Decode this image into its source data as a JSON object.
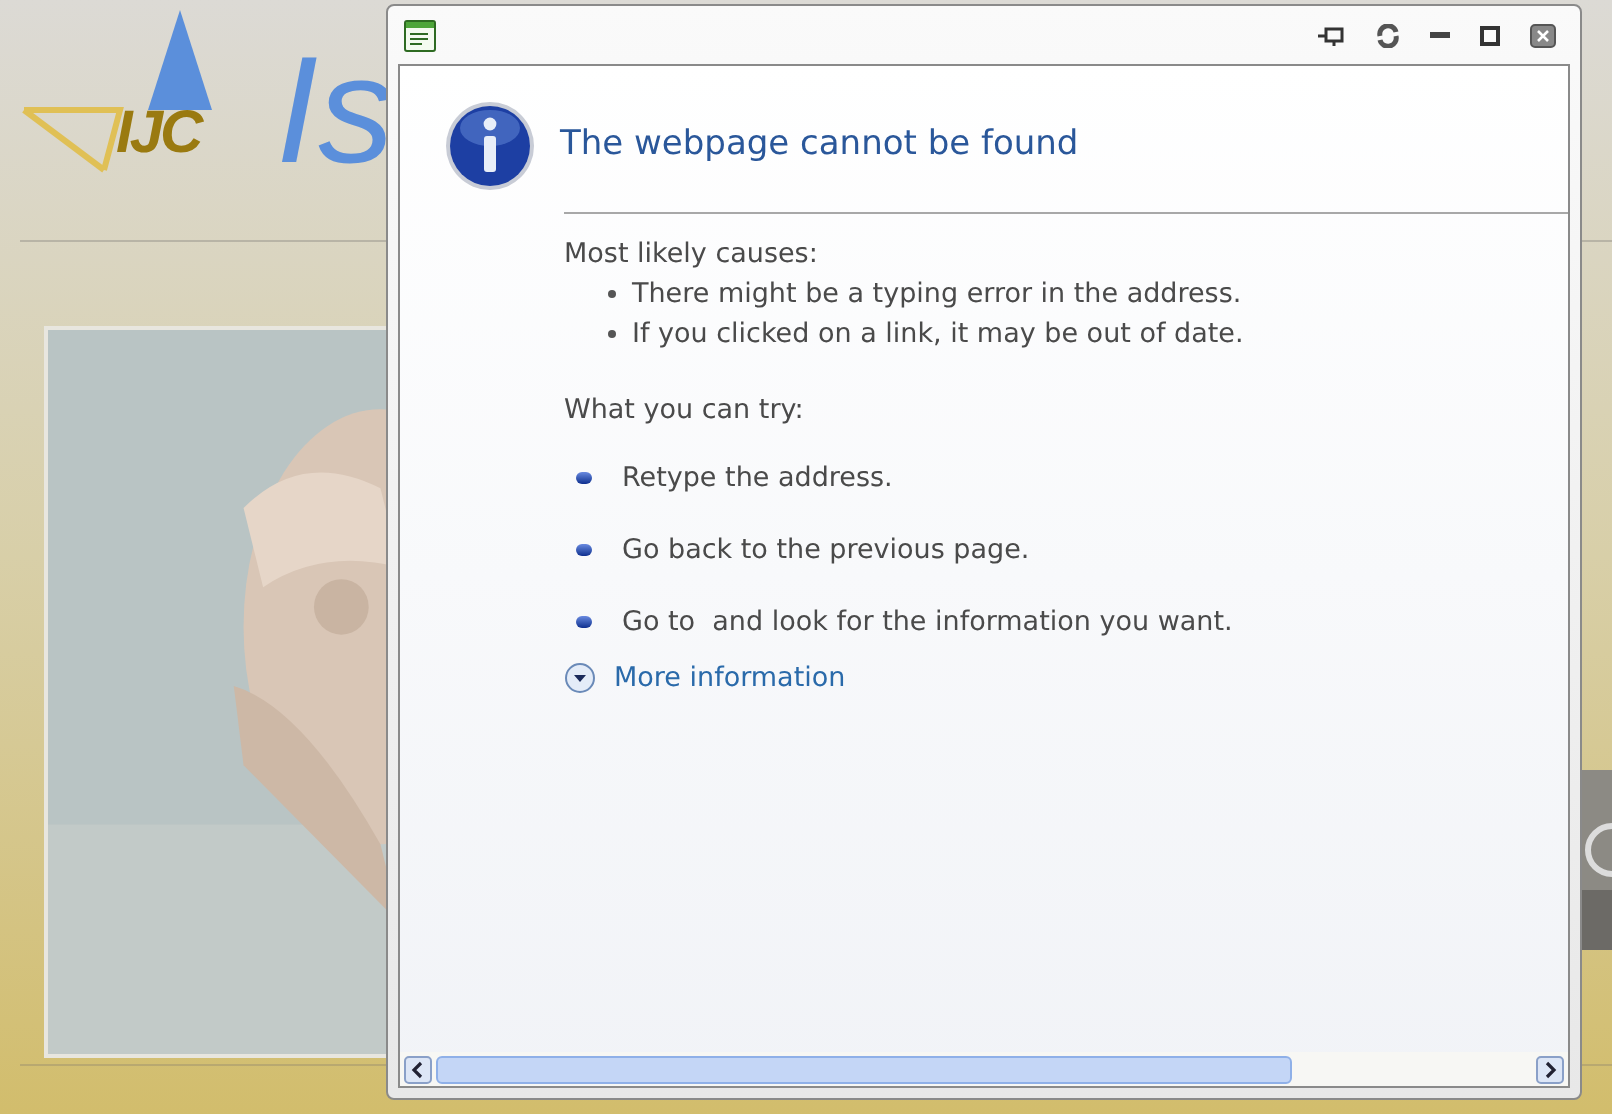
{
  "background_page": {
    "logo_text": "IJC",
    "heading_fragment": "Is"
  },
  "dialog": {
    "title": "The webpage cannot be found",
    "causes_heading": "Most likely causes:",
    "causes": [
      "There might be a typing error in the address.",
      "If you clicked on a link, it may be out of date."
    ],
    "try_heading": "What you can try:",
    "suggestions": [
      "Retype the address.",
      "Go back to the previous page.",
      "Go to  and look for the information you want."
    ],
    "more_info": "More information"
  }
}
